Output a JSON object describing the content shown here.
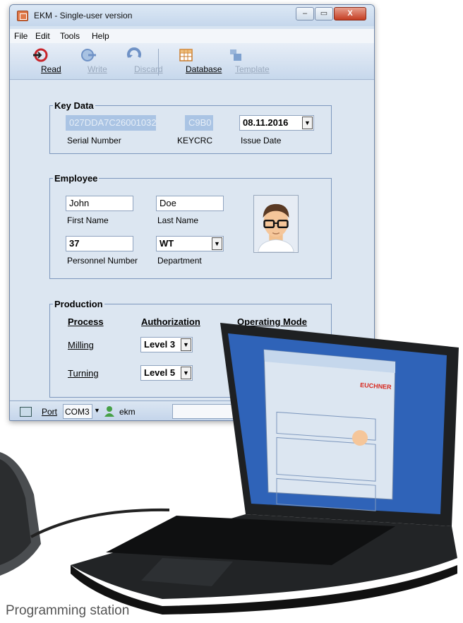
{
  "window": {
    "title": "EKM - Single-user version",
    "controls": {
      "minimize": "–",
      "maximize": "▭",
      "close": "X"
    }
  },
  "menu": [
    {
      "label": "File"
    },
    {
      "label": "Edit"
    },
    {
      "label": "Tools"
    },
    {
      "label": "Help"
    }
  ],
  "toolbar": {
    "read": "Read",
    "write": "Write",
    "discard": "Discard",
    "database": "Database",
    "template": "Template",
    "brand": "EUCHNER"
  },
  "key_data": {
    "legend": "Key Data",
    "serial_value": "027DDA7C26001032",
    "serial_label": "Serial Number",
    "keycrc_value": "C9B0",
    "keycrc_label": "KEYCRC",
    "issue_date_value": "08.11.2016",
    "issue_date_label": "Issue Date"
  },
  "employee": {
    "legend": "Employee",
    "first_name_value": "John",
    "first_name_label": "First Name",
    "last_name_value": "Doe",
    "last_name_label": "Last Name",
    "personnel_value": "37",
    "personnel_label": "Personnel Number",
    "department_value": "WT",
    "department_label": "Department"
  },
  "production": {
    "legend": "Production",
    "col_process": "Process",
    "col_authorization": "Authorization",
    "col_operating_mode": "Operating Mode",
    "rows": [
      {
        "process": "Milling",
        "authorization": "Level 3"
      },
      {
        "process": "Turning",
        "authorization": "Level 5"
      }
    ]
  },
  "statusbar": {
    "port_label": "Port",
    "port_value": "COM3",
    "user": "ekm"
  },
  "caption": "Programming station",
  "colors": {
    "brand": "#d8271d",
    "readonly_field": "#aac4e4",
    "group_border": "#7d97bd"
  }
}
